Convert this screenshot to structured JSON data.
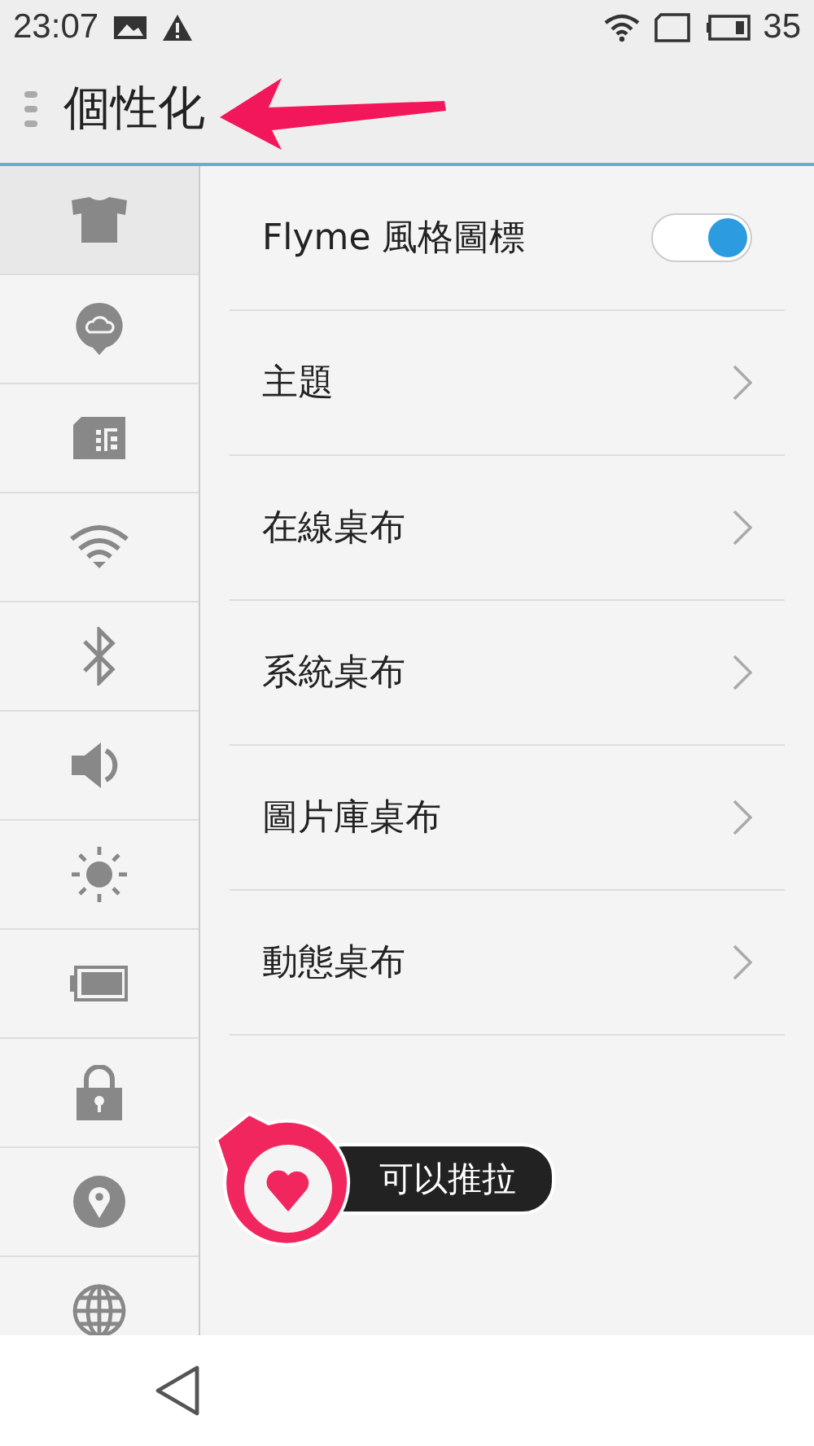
{
  "status_bar": {
    "time": "23:07",
    "battery": "35"
  },
  "header": {
    "title": "個性化"
  },
  "sidebar": {
    "items": [
      {
        "kind": "shirt",
        "selected": true
      },
      {
        "kind": "cloud",
        "selected": false
      },
      {
        "kind": "sim",
        "selected": false
      },
      {
        "kind": "wifi",
        "selected": false
      },
      {
        "kind": "bluetooth",
        "selected": false
      },
      {
        "kind": "sound",
        "selected": false
      },
      {
        "kind": "brightness",
        "selected": false
      },
      {
        "kind": "battery",
        "selected": false
      },
      {
        "kind": "lock",
        "selected": false
      },
      {
        "kind": "location",
        "selected": false
      },
      {
        "kind": "globe",
        "selected": false
      }
    ]
  },
  "settings": [
    {
      "kind": "toggle",
      "label": "Flyme 風格圖標",
      "on": true
    },
    {
      "kind": "link",
      "label": "主題"
    },
    {
      "kind": "link",
      "label": "在線桌布"
    },
    {
      "kind": "link",
      "label": "系統桌布"
    },
    {
      "kind": "link",
      "label": "圖片庫桌布"
    },
    {
      "kind": "link",
      "label": "動態桌布"
    }
  ],
  "tooltip": {
    "text": "可以推拉"
  }
}
